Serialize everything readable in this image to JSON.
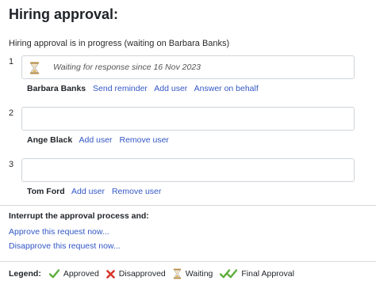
{
  "title": "Hiring approval:",
  "status_text": "Hiring approval is in progress (waiting on Barbara Banks)",
  "steps": [
    {
      "number": "1",
      "box_text": "Waiting for response since 16 Nov 2023",
      "user": "Barbara Banks",
      "links": [
        "Send reminder",
        "Add user",
        "Answer on behalf"
      ]
    },
    {
      "number": "2",
      "box_text": "",
      "user": "Ange Black",
      "links": [
        "Add user",
        "Remove user"
      ]
    },
    {
      "number": "3",
      "box_text": "",
      "user": "Tom Ford",
      "links": [
        "Add user",
        "Remove user"
      ]
    }
  ],
  "interrupt": {
    "title": "Interrupt the approval process and:",
    "approve_link": "Approve this request now...",
    "disapprove_link": "Disapprove this request now..."
  },
  "legend": {
    "label": "Legend:",
    "items": [
      {
        "icon": "check-icon",
        "label": "Approved"
      },
      {
        "icon": "cross-icon",
        "label": "Disapproved"
      },
      {
        "icon": "hourglass-icon",
        "label": "Waiting"
      },
      {
        "icon": "double-check-icon",
        "label": "Final Approval"
      }
    ]
  },
  "colors": {
    "link": "#3357c7",
    "approved": "#5fae3c",
    "disapproved": "#d9352b",
    "hourglass": "#c9a04a"
  }
}
